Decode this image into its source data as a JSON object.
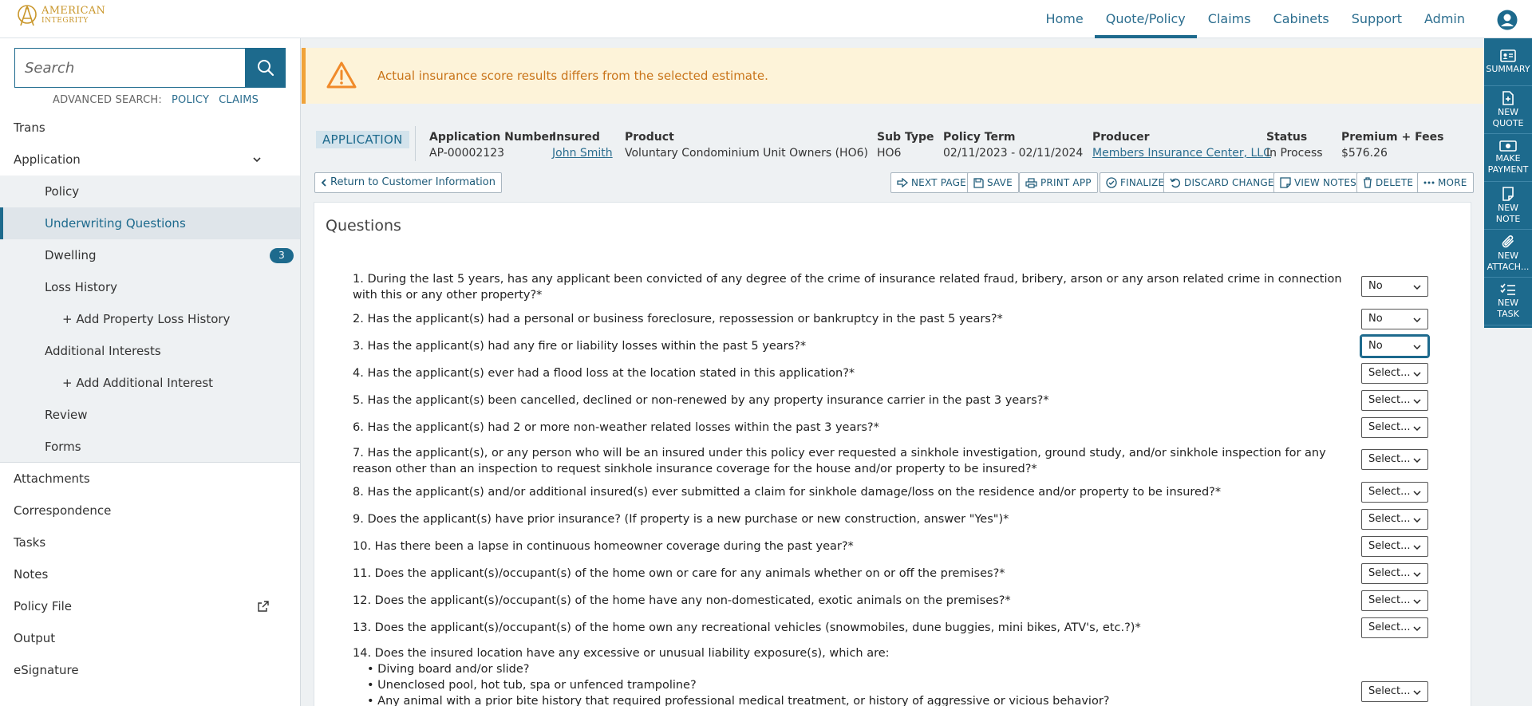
{
  "brand": {
    "line1": "AMERICAN",
    "line2": "INTEGRITY"
  },
  "topnav": [
    {
      "label": "Home",
      "active": false
    },
    {
      "label": "Quote/Policy",
      "active": true
    },
    {
      "label": "Claims",
      "active": false
    },
    {
      "label": "Cabinets",
      "active": false
    },
    {
      "label": "Support",
      "active": false
    },
    {
      "label": "Admin",
      "active": false
    }
  ],
  "search": {
    "placeholder": "Search",
    "advanced_label": "ADVANCED SEARCH:",
    "policy_link": "POLICY",
    "claims_link": "CLAIMS"
  },
  "sidebar": {
    "items": [
      {
        "label": "Trans"
      },
      {
        "label": "Application"
      },
      {
        "label": "Policy"
      },
      {
        "label": "Underwriting Questions"
      },
      {
        "label": "Dwelling",
        "badge": "3"
      },
      {
        "label": "Loss History"
      },
      {
        "label": "+ Add Property Loss History"
      },
      {
        "label": "Additional Interests"
      },
      {
        "label": "+ Add Additional Interest"
      },
      {
        "label": "Review"
      },
      {
        "label": "Forms"
      },
      {
        "label": "Attachments"
      },
      {
        "label": "Correspondence"
      },
      {
        "label": "Tasks"
      },
      {
        "label": "Notes"
      },
      {
        "label": "Policy File"
      },
      {
        "label": "Output"
      },
      {
        "label": "eSignature"
      }
    ]
  },
  "rail": [
    {
      "label": "SUMMARY",
      "icon": "id-card-icon"
    },
    {
      "label": "NEW QUOTE",
      "icon": "new-document-icon"
    },
    {
      "label": "MAKE PAYMENT",
      "icon": "money-icon"
    },
    {
      "label": "NEW NOTE",
      "icon": "note-icon"
    },
    {
      "label": "NEW ATTACH...",
      "icon": "paperclip-icon"
    },
    {
      "label": "NEW TASK",
      "icon": "task-list-icon"
    }
  ],
  "alert": {
    "message": "Actual insurance score results differs from the selected estimate."
  },
  "application": {
    "tag": "APPLICATION",
    "fields": [
      {
        "label": "Application Number",
        "value": "AP-00002123"
      },
      {
        "label": "Insured",
        "value": "John Smith"
      },
      {
        "label": "Product",
        "value": "Voluntary Condominium Unit Owners (HO6)"
      },
      {
        "label": "Sub Type",
        "value": "HO6"
      },
      {
        "label": "Policy Term",
        "value": "02/11/2023 - 02/11/2024"
      },
      {
        "label": "Producer",
        "value": "Members Insurance Center, LLC"
      },
      {
        "label": "Status",
        "value": "In Process"
      },
      {
        "label": "Premium + Fees",
        "value": "$576.26"
      }
    ]
  },
  "actions": {
    "return": "Return to Customer Information",
    "next_page": "NEXT PAGE",
    "save": "SAVE",
    "print_app": "PRINT APP",
    "finalize": "FINALIZE",
    "discard": "DISCARD CHANGES",
    "view_notes": "VIEW NOTES",
    "delete": "DELETE",
    "more": "MORE"
  },
  "questions": {
    "title": "Questions",
    "items": [
      {
        "text": "1. During the last 5 years, has any applicant been convicted of any degree of the crime of insurance related fraud, bribery, arson or any arson related crime in connection with this or any other property?*",
        "answer": "No"
      },
      {
        "text": "2. Has the applicant(s) had a personal or business foreclosure, repossession or bankruptcy in the past 5 years?*",
        "answer": "No"
      },
      {
        "text": "3. Has the applicant(s) had any fire or liability losses within the past 5 years?*",
        "answer": "No"
      },
      {
        "text": "4. Has the applicant(s) ever had a flood loss at the location stated in this application?*",
        "answer": "Select..."
      },
      {
        "text": "5. Has the applicant(s) been cancelled, declined or non-renewed by any property insurance carrier in the past 3 years?*",
        "answer": "Select..."
      },
      {
        "text": "6. Has the applicant(s) had 2 or more non-weather related losses within the past 3 years?*",
        "answer": "Select..."
      },
      {
        "text": "7. Has the applicant(s), or any person who will be an insured under this policy ever requested a sinkhole investigation, ground study, and/or sinkhole inspection for any reason other than an inspection to request sinkhole insurance coverage for the house and/or property to be insured?*",
        "answer": "Select..."
      },
      {
        "text": "8. Has the applicant(s) and/or additional insured(s) ever submitted a claim for sinkhole damage/loss on the residence and/or property to be insured?*",
        "answer": "Select..."
      },
      {
        "text": "9. Does the applicant(s) have prior insurance? (If property is a new purchase or new construction, answer \"Yes\")*",
        "answer": "Select..."
      },
      {
        "text": "10. Has there been a lapse in continuous homeowner coverage during the past year?*",
        "answer": "Select..."
      },
      {
        "text": "11. Does the applicant(s)/occupant(s) of the home own or care for any animals whether on or off the premises?*",
        "answer": "Select..."
      },
      {
        "text": "12. Does the applicant(s)/occupant(s) of the home have any non-domesticated, exotic animals on the premises?*",
        "answer": "Select..."
      },
      {
        "text": "13. Does the applicant(s)/occupant(s) of the home own any recreational vehicles (snowmobiles, dune buggies, mini bikes, ATV's, etc.?)*",
        "answer": "Select..."
      },
      {
        "text": "14. Does the insured location have any excessive or unusual liability exposure(s), which are:",
        "answer": "Select...",
        "bullets": [
          "• Diving board and/or slide?",
          "• Unenclosed pool, hot tub, spa or unfenced trampoline?",
          "• Any animal with a prior bite history that required professional medical treatment, or history of aggressive or vicious behavior?"
        ]
      }
    ]
  }
}
